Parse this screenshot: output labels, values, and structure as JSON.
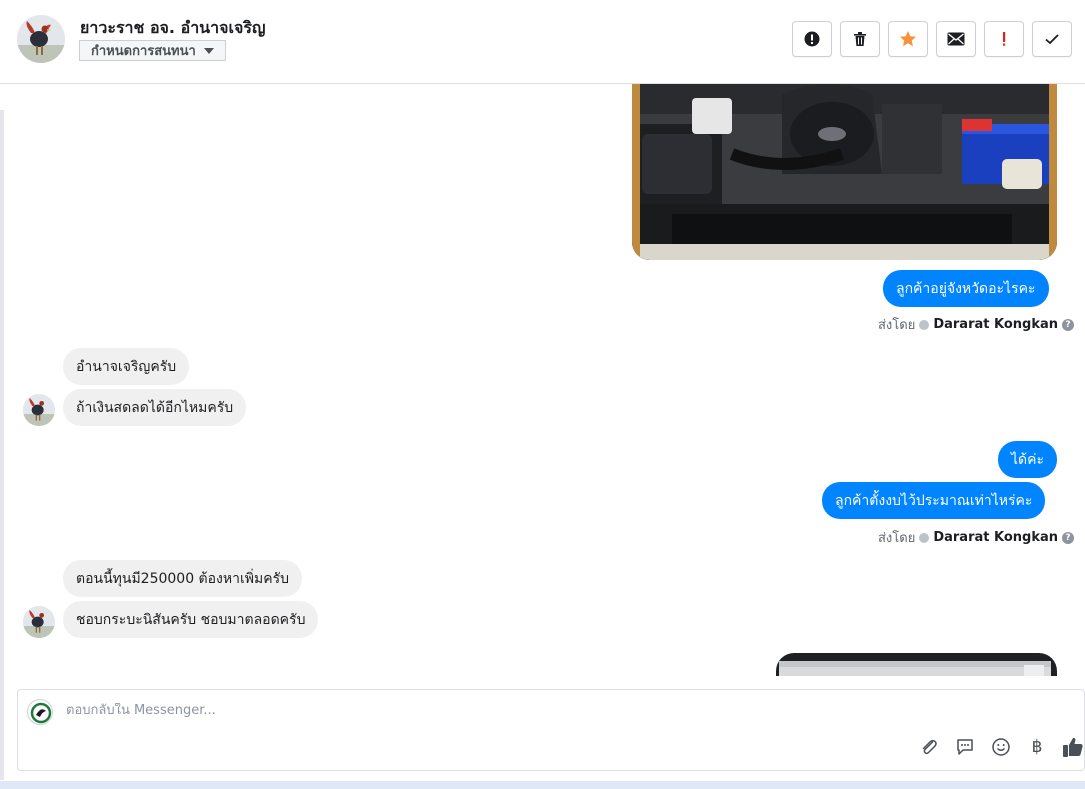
{
  "header": {
    "contact_name": "ยาวะราช อจ. อำนาจเจริญ",
    "assign_label": "กำหนดการสนทนา",
    "toolbar": [
      {
        "name": "spam-button",
        "icon": "alert-circle-icon"
      },
      {
        "name": "delete-button",
        "icon": "trash-icon"
      },
      {
        "name": "star-button",
        "icon": "star-icon"
      },
      {
        "name": "mark-unread-button",
        "icon": "envelope-icon"
      },
      {
        "name": "follow-up-button",
        "icon": "exclamation-icon"
      },
      {
        "name": "mark-done-button",
        "icon": "check-icon"
      }
    ]
  },
  "messages": {
    "m1": "ลูกค้าอยู่จังหวัดอะไรคะ",
    "m2": "อำนาจเจริญครับ",
    "m3": "ถ้าเงินสดลดได้อีกไหมครับ",
    "m4": "ได้ค่ะ",
    "m5": "ลูกค้าตั้งงบไว้ประมาณเท่าไหร่คะ",
    "m6": "ตอนนี้ทุนมี250000 ต้องหาเพิ่มครับ",
    "m7": "ชอบกระบะนิสันครับ ชอบมาตลอดครับ"
  },
  "sent_by": {
    "label": "ส่งโดย",
    "sender": "Dararat Kongkan",
    "help": "?"
  },
  "composer": {
    "placeholder": "ตอบกลับใน Messenger...",
    "icons": [
      "paperclip-icon",
      "saved-reply-icon",
      "emoji-icon",
      "baht-icon",
      "thumbs-up-icon"
    ],
    "baht_symbol": "฿"
  },
  "colors": {
    "outgoing_bubble": "#0084ff",
    "incoming_bubble": "#f1f0f0",
    "star": "#f7923b",
    "follow_up": "#e02020"
  }
}
